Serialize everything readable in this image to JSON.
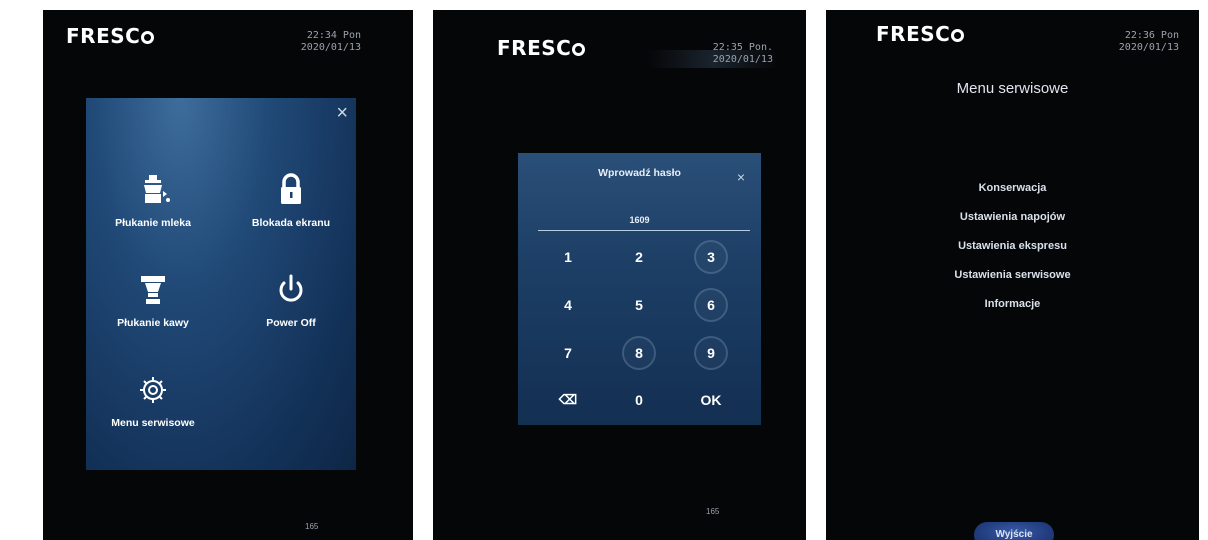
{
  "panels": [
    {
      "logo": "FRESC",
      "time": "22:34  Pon",
      "date": "2020/01/13",
      "close_glyph": "×",
      "menu_items": [
        {
          "label": "Płukanie mleka",
          "icon": "milk-rinse-icon"
        },
        {
          "label": "Blokada ekranu",
          "icon": "lock-icon"
        },
        {
          "label": "Płukanie kawy",
          "icon": "coffee-rinse-icon"
        },
        {
          "label": "Power Off",
          "icon": "power-icon"
        },
        {
          "label": "Menu serwisowe",
          "icon": "gear-icon"
        }
      ],
      "footer": "165"
    },
    {
      "logo": "FRESC",
      "time": "22:35  Pon.",
      "date": "2020/01/13",
      "dialog_title": "Wprowadź hasło",
      "close_glyph": "×",
      "password_value": "1609",
      "keys": [
        "1",
        "2",
        "3",
        "4",
        "5",
        "6",
        "7",
        "8",
        "9",
        "⌫",
        "0",
        "OK"
      ],
      "footer": "165"
    },
    {
      "logo": "FRESC",
      "time": "22:36  Pon",
      "date": "2020/01/13",
      "title": "Menu serwisowe",
      "menu_items": [
        "Konserwacja",
        "Ustawienia napojów",
        "Ustawienia ekspresu",
        "Ustawienia serwisowe",
        "Informacje"
      ],
      "exit_label": "Wyjście"
    }
  ],
  "colors": {
    "background": "#050608",
    "panel_blue": "#1d3f66",
    "exit_button": "#223e80"
  }
}
